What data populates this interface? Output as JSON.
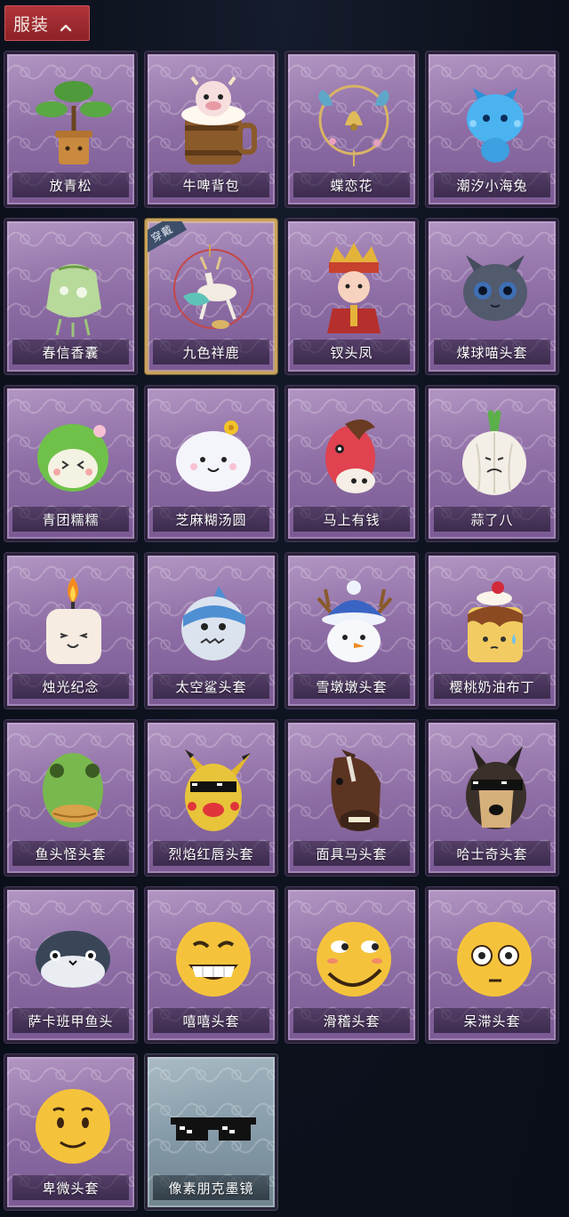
{
  "section": {
    "title": "服装",
    "toggle_icon": "chevron-up-icon"
  },
  "colors": {
    "header_red": "#a52c31",
    "card_purple": "#9272a8",
    "card_grey": "#8a9fab",
    "selected_gold": "#c9a35a",
    "page_bg": "#0d1220"
  },
  "equipped_badge": "穿戴",
  "items": [
    {
      "name": "放青松",
      "icon": "bonsai-pine-icon"
    },
    {
      "name": "牛啤背包",
      "icon": "cow-beer-barrel-backpack-icon"
    },
    {
      "name": "蝶恋花",
      "icon": "butterfly-bell-ornament-icon"
    },
    {
      "name": "潮汐小海兔",
      "icon": "blue-sea-bunny-icon"
    },
    {
      "name": "春信香囊",
      "icon": "green-sachet-icon"
    },
    {
      "name": "九色祥鹿",
      "icon": "nine-color-deer-icon",
      "equipped": true
    },
    {
      "name": "钗头凤",
      "icon": "phoenix-crown-doll-icon"
    },
    {
      "name": "煤球喵头套",
      "icon": "black-cat-head-icon"
    },
    {
      "name": "青团糯糯",
      "icon": "green-rice-ball-icon"
    },
    {
      "name": "芝麻糊汤圆",
      "icon": "sesame-dumpling-icon"
    },
    {
      "name": "马上有钱",
      "icon": "red-horse-head-icon"
    },
    {
      "name": "蒜了八",
      "icon": "garlic-head-icon"
    },
    {
      "name": "烛光纪念",
      "icon": "candle-head-icon"
    },
    {
      "name": "太空鲨头套",
      "icon": "space-shark-head-icon"
    },
    {
      "name": "雪墩墩头套",
      "icon": "snowman-reindeer-head-icon"
    },
    {
      "name": "樱桃奶油布丁",
      "icon": "cherry-pudding-head-icon"
    },
    {
      "name": "鱼头怪头套",
      "icon": "fish-monster-head-icon"
    },
    {
      "name": "烈焰红唇头套",
      "icon": "red-lips-pikachu-head-icon"
    },
    {
      "name": "面具马头套",
      "icon": "horse-mask-head-icon"
    },
    {
      "name": "哈士奇头套",
      "icon": "husky-sunglasses-head-icon"
    },
    {
      "name": "萨卡班甲鱼头",
      "icon": "sacabambaspis-head-icon"
    },
    {
      "name": "嘻嘻头套",
      "icon": "grinning-emoji-head-icon"
    },
    {
      "name": "滑稽头套",
      "icon": "funny-smirk-emoji-head-icon"
    },
    {
      "name": "呆滞头套",
      "icon": "dazed-emoji-head-icon"
    },
    {
      "name": "卑微头套",
      "icon": "humble-emoji-head-icon"
    },
    {
      "name": "像素朋克墨镜",
      "icon": "pixel-sunglasses-icon",
      "variant": "grey"
    }
  ]
}
